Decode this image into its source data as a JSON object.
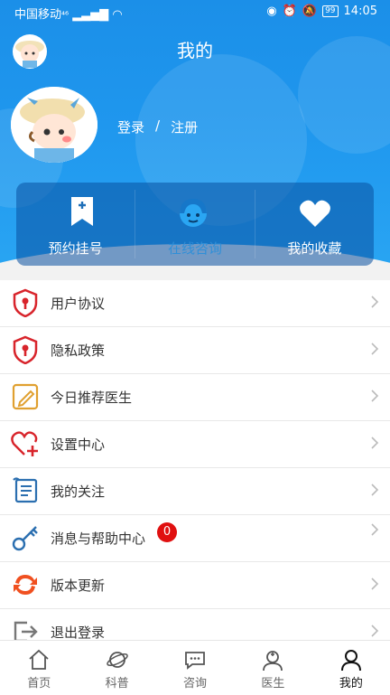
{
  "status_bar": {
    "carrier": "中国移动",
    "signal": "⁴⁶",
    "battery": "99",
    "time": "14:05"
  },
  "header": {
    "title": "我的"
  },
  "account": {
    "login": "登录",
    "separator": "/",
    "register": "注册"
  },
  "quick_actions": [
    {
      "label": "预约挂号",
      "icon": "bookmark-plus-icon"
    },
    {
      "label": "在线咨询",
      "icon": "consultant-icon"
    },
    {
      "label": "我的收藏",
      "icon": "heart-icon"
    }
  ],
  "menu": [
    {
      "label": "用户协议",
      "icon": "shield-key-icon"
    },
    {
      "label": "隐私政策",
      "icon": "shield-key-icon"
    },
    {
      "label": "今日推荐医生",
      "icon": "edit-note-icon"
    },
    {
      "label": "设置中心",
      "icon": "heart-plus-icon"
    },
    {
      "label": "我的关注",
      "icon": "scroll-icon"
    },
    {
      "label": "消息与帮助中心",
      "icon": "key-icon",
      "badge": "0"
    },
    {
      "label": "版本更新",
      "icon": "refresh-icon"
    },
    {
      "label": "退出登录",
      "icon": "logout-icon"
    }
  ],
  "tabs": [
    {
      "label": "首页",
      "icon": "home-icon"
    },
    {
      "label": "科普",
      "icon": "planet-icon"
    },
    {
      "label": "咨询",
      "icon": "chat-icon"
    },
    {
      "label": "医生",
      "icon": "doctor-icon"
    },
    {
      "label": "我的",
      "icon": "person-icon",
      "active": true
    }
  ],
  "colors": {
    "primary": "#1f97ee",
    "badge": "#e01010",
    "shield": "#d8242b",
    "note": "#e0a030",
    "refresh": "#f05020"
  }
}
